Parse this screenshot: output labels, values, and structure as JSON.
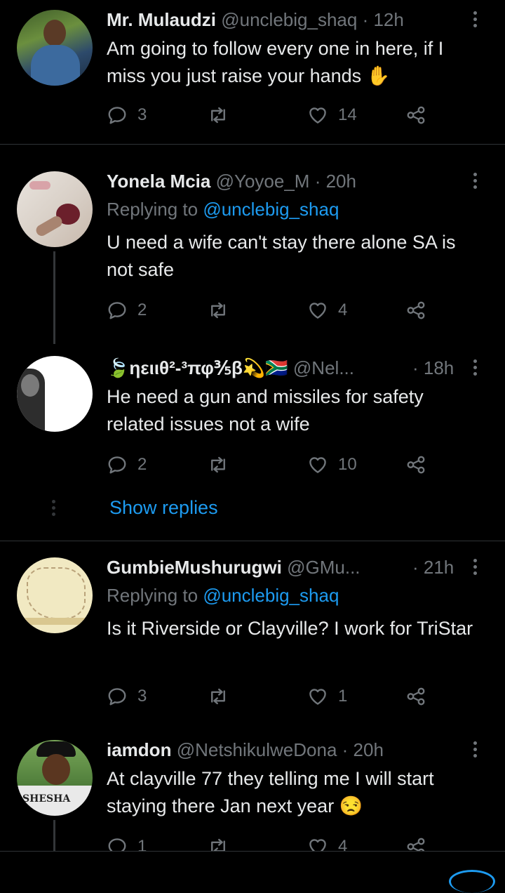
{
  "tweets": [
    {
      "name": "Mr. Mulaudzi",
      "handle": "@unclebig_shaq",
      "time": "· 12h",
      "replying_prefix": "",
      "replying_to": "",
      "text": "Am going to follow every one in here, if I miss you just raise your hands ✋",
      "replies": "3",
      "retweets": "",
      "likes": "14"
    },
    {
      "name": "Yonela Mcia",
      "handle": "@Yoyoe_M",
      "time": "· 20h",
      "replying_prefix": "Replying to",
      "replying_to": "@unclebig_shaq",
      "text": "U need a wife can't stay there alone SA is not safe",
      "replies": "2",
      "retweets": "",
      "likes": "4"
    },
    {
      "name": "🍃ηειιθ²-³πφ⅗β💫🇿🇦",
      "handle": "@Nel...",
      "time": "· 18h",
      "replying_prefix": "",
      "replying_to": "",
      "text": "He need a gun and missiles for safety related issues not a wife",
      "replies": "2",
      "retweets": "",
      "likes": "10"
    },
    {
      "name": "GumbieMushurugwi",
      "handle": "@GMu...",
      "time": "· 21h",
      "replying_prefix": "Replying to",
      "replying_to": "@unclebig_shaq",
      "text": "Is it Riverside or Clayville? I work for TriStar",
      "replies": "3",
      "retweets": "",
      "likes": "1"
    },
    {
      "name": "iamdon",
      "handle": "@NetshikulweDona",
      "time": "· 20h",
      "replying_prefix": "",
      "replying_to": "",
      "text": "At clayville 77 they telling me I will start staying there Jan next year 😒",
      "replies": "1",
      "retweets": "",
      "likes": "4"
    }
  ],
  "show_replies_label": "Show replies",
  "avatar_3_text": "SHESHA",
  "colors": {
    "background": "#000000",
    "text": "#e7e9ea",
    "muted": "#71767b",
    "accent": "#1d9bf0",
    "divider": "#2f3336"
  }
}
